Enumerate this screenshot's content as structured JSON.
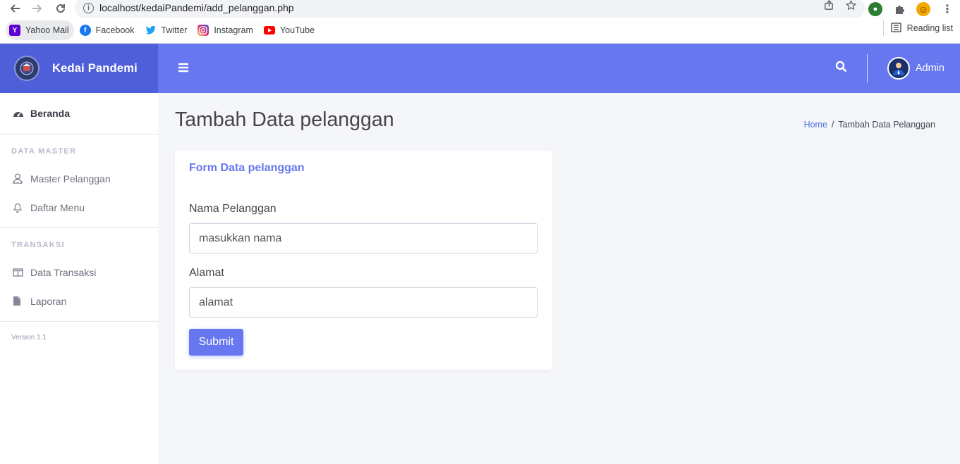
{
  "browser": {
    "url": "localhost/kedaiPandemi/add_pelanggan.php",
    "bookmarks": [
      {
        "label": "Yahoo Mail",
        "icon": "yahoo-icon",
        "color": "#5f01d1"
      },
      {
        "label": "Facebook",
        "icon": "facebook-icon",
        "color": "#1877f2"
      },
      {
        "label": "Twitter",
        "icon": "twitter-icon",
        "color": "#1da1f2"
      },
      {
        "label": "Instagram",
        "icon": "instagram-icon",
        "color": "#d62976"
      },
      {
        "label": "YouTube",
        "icon": "youtube-icon",
        "color": "#ff0000"
      }
    ],
    "reading_list": "Reading list"
  },
  "header": {
    "brand_name": "Kedai Pandemi",
    "user_name": "Admin",
    "accent_color": "#6777ef",
    "brand_bg": "#4e5fd9"
  },
  "sidebar": {
    "dashboard_label": "Beranda",
    "section_master": "DATA MASTER",
    "master_items": [
      {
        "label": "Master Pelanggan",
        "icon": "user-icon"
      },
      {
        "label": "Daftar Menu",
        "icon": "bell-icon"
      }
    ],
    "section_transaksi": "TRANSAKSI",
    "transaksi_items": [
      {
        "label": "Data Transaksi",
        "icon": "columns-icon"
      },
      {
        "label": "Laporan",
        "icon": "file-icon"
      }
    ],
    "version": "Version 1.1"
  },
  "main": {
    "page_title": "Tambah Data pelanggan",
    "breadcrumb_home": "Home",
    "breadcrumb_sep": "/",
    "breadcrumb_current": "Tambah Data Pelanggan",
    "form": {
      "title": "Form Data pelanggan",
      "name_label": "Nama Pelanggan",
      "name_placeholder": "masukkan nama",
      "name_value": "",
      "address_label": "Alamat",
      "address_placeholder": "alamat",
      "address_value": "",
      "submit_label": "Submit"
    }
  }
}
